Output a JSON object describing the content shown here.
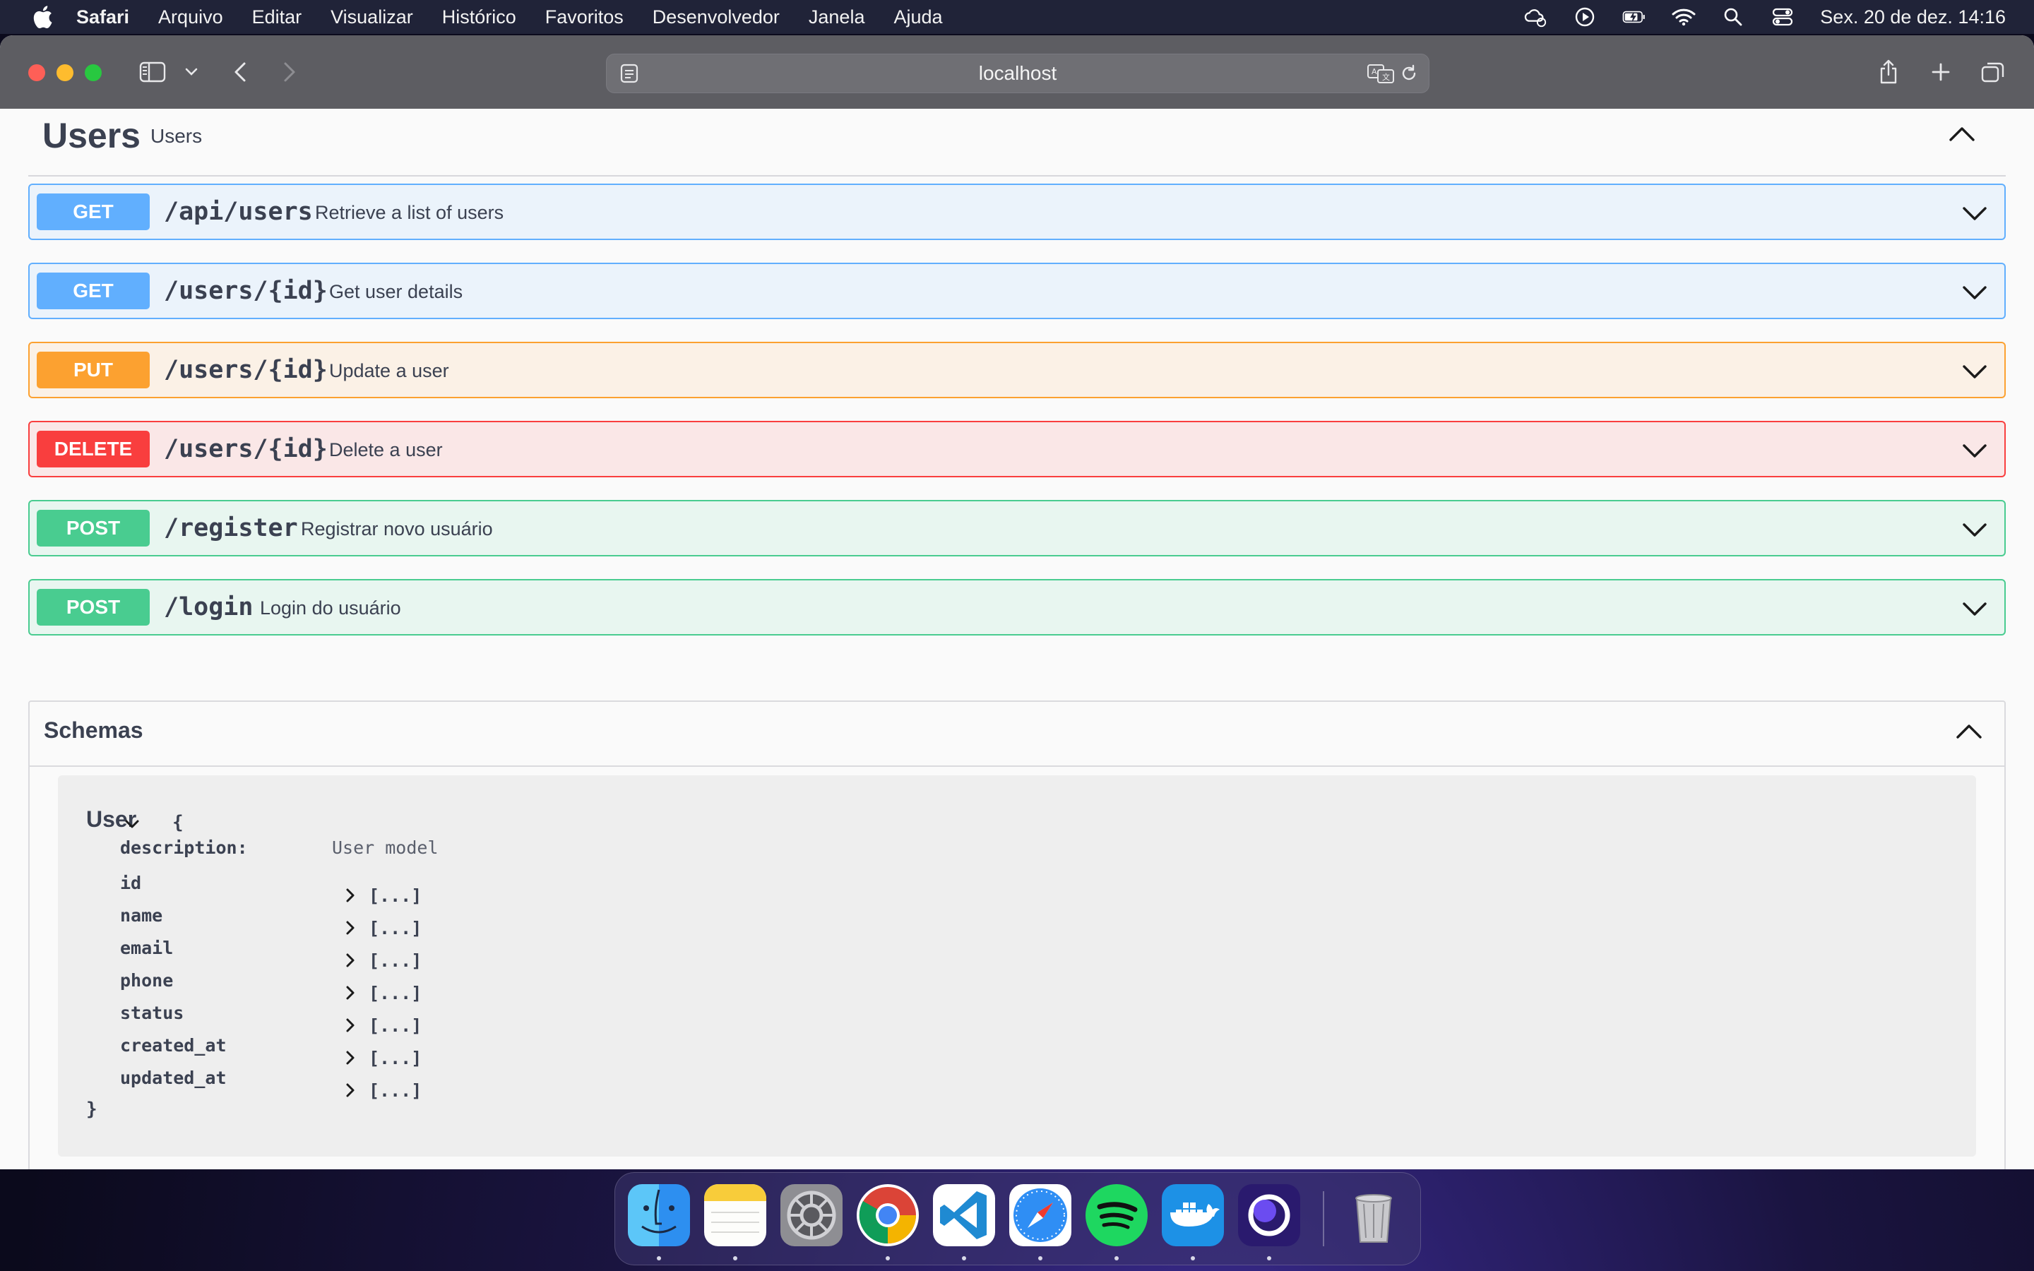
{
  "menubar": {
    "app_name": "Safari",
    "items": [
      "Arquivo",
      "Editar",
      "Visualizar",
      "Histórico",
      "Favoritos",
      "Desenvolvedor",
      "Janela",
      "Ajuda"
    ],
    "clock": "Sex. 20 de dez.  14:16"
  },
  "browser": {
    "url": "localhost"
  },
  "tag": {
    "title": "Users",
    "description": "Users"
  },
  "operations": [
    {
      "method": "GET",
      "path": "/api/users",
      "summary": "Retrieve a list of users"
    },
    {
      "method": "GET",
      "path": "/users/{id}",
      "summary": "Get user details"
    },
    {
      "method": "PUT",
      "path": "/users/{id}",
      "summary": "Update a user"
    },
    {
      "method": "DELETE",
      "path": "/users/{id}",
      "summary": "Delete a user"
    },
    {
      "method": "POST",
      "path": "/register",
      "summary": "Registrar novo usuário"
    },
    {
      "method": "POST",
      "path": "/login",
      "summary": "Login do usuário"
    }
  ],
  "schemas": {
    "title": "Schemas",
    "model": {
      "name": "User",
      "open_brace": "{",
      "close_brace": "}",
      "description_label": "description:",
      "description_value": "User model",
      "properties": [
        {
          "name": "id",
          "value": "[...]"
        },
        {
          "name": "name",
          "value": "[...]"
        },
        {
          "name": "email",
          "value": "[...]"
        },
        {
          "name": "phone",
          "value": "[...]"
        },
        {
          "name": "status",
          "value": "[...]"
        },
        {
          "name": "created_at",
          "value": "[...]"
        },
        {
          "name": "updated_at",
          "value": "[...]"
        }
      ]
    }
  },
  "colors": {
    "get": "#61affe",
    "put": "#fca130",
    "delete": "#f93e3e",
    "post": "#49cc90",
    "text": "#3b4151"
  },
  "dock": {
    "apps": [
      "finder-icon",
      "notes-icon",
      "system-settings-icon",
      "chrome-icon",
      "vscode-icon",
      "safari-icon",
      "spotify-icon",
      "docker-icon",
      "app-icon",
      "trash-icon"
    ]
  }
}
